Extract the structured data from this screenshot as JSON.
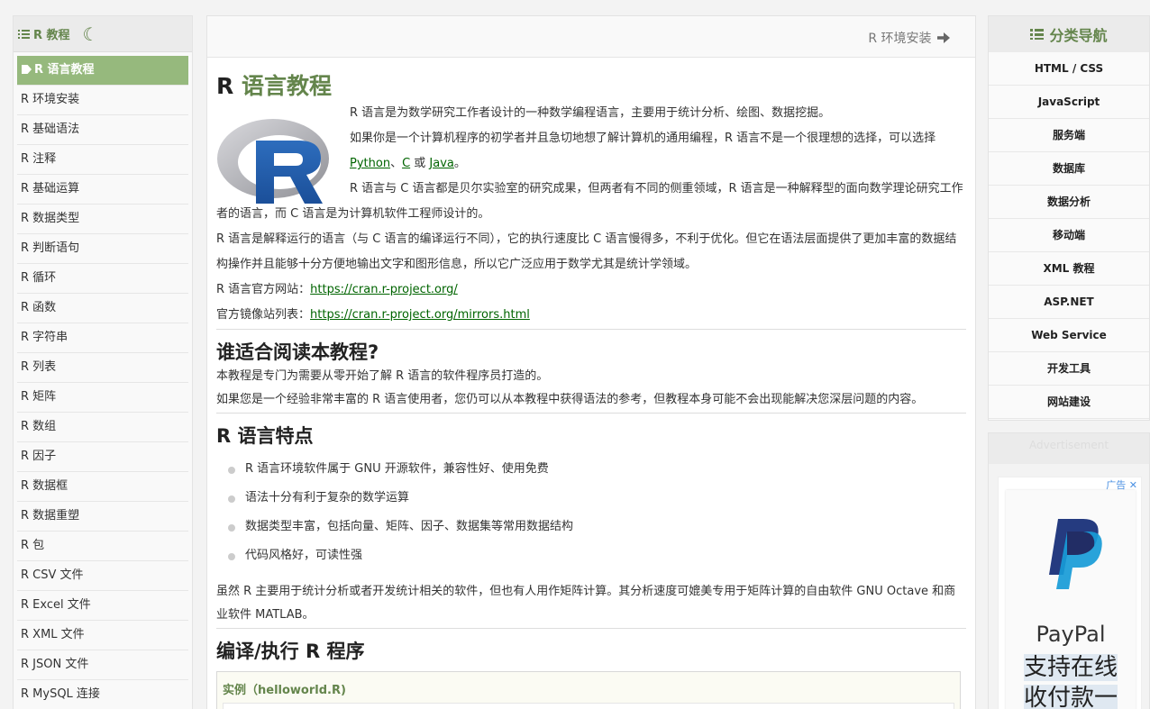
{
  "left_nav": {
    "title": "R 教程",
    "items": [
      "R 语言教程",
      "R 环境安装",
      "R 基础语法",
      "R 注释",
      "R 基础运算",
      "R 数据类型",
      "R 判断语句",
      "R 循环",
      "R 函数",
      "R 字符串",
      "R 列表",
      "R 矩阵",
      "R 数组",
      "R 因子",
      "R 数据框",
      "R 数据重塑",
      "R 包",
      "R CSV 文件",
      "R Excel 文件",
      "R XML 文件",
      "R JSON 文件",
      "R MySQL 连接"
    ],
    "active_index": 0
  },
  "topbar": {
    "next_label": "R 环境安装"
  },
  "article": {
    "title_prefix": "R ",
    "title_highlight": "语言教程",
    "p1": "R 语言是为数学研究工作者设计的一种数学编程语言，主要用于统计分析、绘图、数据挖掘。",
    "p2_a": "如果你是一个计算机程序的初学者并且急切地想了解计算机的通用编程，R 语言不是一个很理想的选择，可以选择 ",
    "link_python": "Python",
    "sep1": "、",
    "link_c": "C",
    "sep2": " 或 ",
    "link_java": "Java",
    "p2_end": "。",
    "p3": "R 语言与 C 语言都是贝尔实验室的研究成果，但两者有不同的侧重领域，R 语言是一种解释型的面向数学理论研究工作者的语言，而 C 语言是为计算机软件工程师设计的。",
    "p4": "R 语言是解释运行的语言（与 C 语言的编译运行不同），它的执行速度比 C 语言慢得多，不利于优化。但它在语法层面提供了更加丰富的数据结构操作并且能够十分方便地输出文字和图形信息，所以它广泛应用于数学尤其是统计学领域。",
    "site_label": "R 语言官方网站：",
    "site_url": "https://cran.r-project.org/",
    "mirror_label": "官方镜像站列表：",
    "mirror_url": "https://cran.r-project.org/mirrors.html",
    "h2_audience": "谁适合阅读本教程?",
    "aud1": "本教程是专门为需要从零开始了解 R 语言的软件程序员打造的。",
    "aud2": "如果您是一个经验非常丰富的 R 语言使用者，您仍可以从本教程中获得语法的参考，但教程本身可能不会出现能解决您深层问题的内容。",
    "h2_features": "R 语言特点",
    "features": [
      "R 语言环境软件属于 GNU 开源软件，兼容性好、使用免费",
      "语法十分有利于复杂的数学运算",
      "数据类型丰富，包括向量、矩阵、因子、数据集等常用数据结构",
      "代码风格好，可读性强"
    ],
    "feat_note": "虽然 R 主要用于统计分析或者开发统计相关的软件，但也有人用作矩阵计算。其分析速度可媲美专用于矩阵计算的自由软件 GNU Octave 和商业软件 MATLAB。",
    "h2_compile": "编译/执行 R 程序",
    "example_title": "实例（helloworld.R)"
  },
  "right_nav": {
    "title": "分类导航",
    "items": [
      "HTML / CSS",
      "JavaScript",
      "服务端",
      "数据库",
      "数据分析",
      "移动端",
      "XML 教程",
      "ASP.NET",
      "Web Service",
      "开发工具",
      "网站建设"
    ]
  },
  "ad": {
    "title": "Advertisement",
    "label": "广告",
    "close": "✕",
    "brand": "PayPal",
    "slogan_1": "支持在线",
    "slogan_2": "收付款一"
  },
  "colors": {
    "accent": "#64854c",
    "active_bg": "#96b97d",
    "link": "#006400"
  },
  "icons": {
    "moon": "moon-icon",
    "list": "list-icon",
    "tag": "tag-icon",
    "arrow": "arrow-right-icon"
  }
}
